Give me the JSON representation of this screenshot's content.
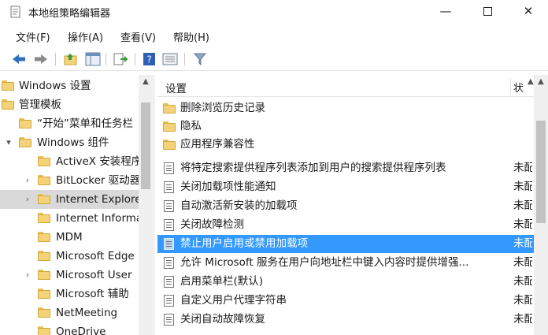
{
  "window": {
    "title": "本地组策略编辑器",
    "minimize": "—",
    "close": "✕"
  },
  "menu": [
    "文件(F)",
    "操作(A)",
    "查看(V)",
    "帮助(H)"
  ],
  "tree": {
    "items": [
      {
        "label": "Windows 设置",
        "expander": ""
      },
      {
        "label": "管理模板",
        "expander": ""
      },
      {
        "label": "“开始”菜单和任务栏",
        "expander": ""
      },
      {
        "label": "Windows 组件",
        "expander": "▾"
      },
      {
        "label": "ActiveX 安装程序",
        "expander": ""
      },
      {
        "label": "BitLocker 驱动器",
        "expander": "›"
      },
      {
        "label": "Internet Explorer",
        "expander": "›"
      },
      {
        "label": "Internet Information",
        "expander": ""
      },
      {
        "label": "MDM",
        "expander": ""
      },
      {
        "label": "Microsoft Edge",
        "expander": ""
      },
      {
        "label": "Microsoft User",
        "expander": "›"
      },
      {
        "label": "Microsoft 辅助",
        "expander": ""
      },
      {
        "label": "NetMeeting",
        "expander": ""
      },
      {
        "label": "OneDrive",
        "expander": ""
      }
    ]
  },
  "list": {
    "header_setting": "设置",
    "header_state": "状",
    "rows": [
      {
        "type": "folder",
        "label": "删除浏览历史记录",
        "state": ""
      },
      {
        "type": "folder",
        "label": "隐私",
        "state": ""
      },
      {
        "type": "folder",
        "label": "应用程序兼容性",
        "state": ""
      },
      {
        "type": "policy",
        "label": "将特定搜索提供程序列表添加到用户的搜索提供程序列表",
        "state": "未配置"
      },
      {
        "type": "policy",
        "label": "关闭加载项性能通知",
        "state": "未配置"
      },
      {
        "type": "policy",
        "label": "自动激活新安装的加载项",
        "state": "未配置"
      },
      {
        "type": "policy",
        "label": "关闭故障检测",
        "state": "未配置"
      },
      {
        "type": "policy",
        "label": "禁止用户启用或禁用加载项",
        "state": "未配置"
      },
      {
        "type": "policy",
        "label": "允许 Microsoft 服务在用户向地址栏中键入内容时提供增强...",
        "state": "未配置"
      },
      {
        "type": "policy",
        "label": "启用菜单栏(默认)",
        "state": "未配置"
      },
      {
        "type": "policy",
        "label": "自定义用户代理字符串",
        "state": "未配置"
      },
      {
        "type": "policy",
        "label": "关闭自动故障恢复",
        "state": "未配置"
      }
    ]
  },
  "colors": {
    "selection": "#3399ff",
    "folder": "#f3d27a"
  }
}
